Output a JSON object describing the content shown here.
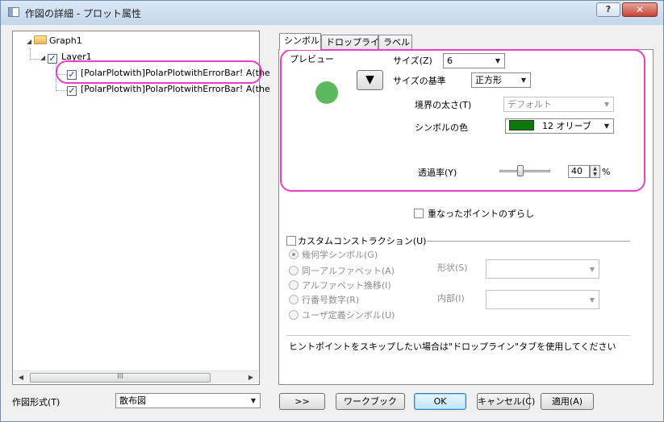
{
  "window": {
    "title": "作図の詳細 - プロット属性",
    "help_label": "?",
    "close_label": "✕"
  },
  "tree": {
    "graph_label": "Graph1",
    "layer_label": "Layer1",
    "plots": [
      {
        "label": "[PolarPlotwith]PolarPlotwithErrorBar!  A(the",
        "checked": true
      },
      {
        "label": "[PolarPlotwith]PolarPlotwithErrorBar!  A(the",
        "checked": true
      }
    ],
    "scroll_grip": "III"
  },
  "tabs": [
    "シンボル",
    "ドロップライン",
    "ラベル"
  ],
  "symbol": {
    "preview_label": "プレビュー",
    "preview_color": "#5cb85c",
    "size_label": "サイズ(Z)",
    "size_value": "6",
    "size_basis_label": "サイズの基準",
    "size_basis_value": "正方形",
    "edge_thickness_label": "境界の太さ(T)",
    "edge_thickness_value": "デフォルト",
    "symbol_color_label": "シンボルの色",
    "symbol_color_value": "12 オリーブ",
    "symbol_color_hex": "#0a7a0a",
    "transparency_label": "透過率(Y)",
    "transparency_value": "40",
    "transparency_unit": "%",
    "overlap_label": "重なったポイントのずらし",
    "highlight_color": "#ea3fc4"
  },
  "custom": {
    "enable_label": "カスタムコンストラクション(U)",
    "options": [
      {
        "label": "幾何学シンボル(G)",
        "selected": true
      },
      {
        "label": "同一アルファベット(A)",
        "selected": false
      },
      {
        "label": "アルファベット推移(I)",
        "selected": false
      },
      {
        "label": "行番号数字(R)",
        "selected": false
      },
      {
        "label": "ユーザ定義シンボル(U)",
        "selected": false
      }
    ],
    "shape_label": "形状(S)",
    "interior_label": "内部(I)"
  },
  "hint": "ヒントポイントをスキップしたい場合は\"ドロップライン\"タブを使用してください",
  "footer": {
    "plot_type_label": "作図形式(T)",
    "plot_type_value": "散布図",
    "expand_label": ">>",
    "workbook_label": "ワークブック",
    "ok_label": "OK",
    "cancel_label": "キャンセル(C)",
    "apply_label": "適用(A)"
  }
}
